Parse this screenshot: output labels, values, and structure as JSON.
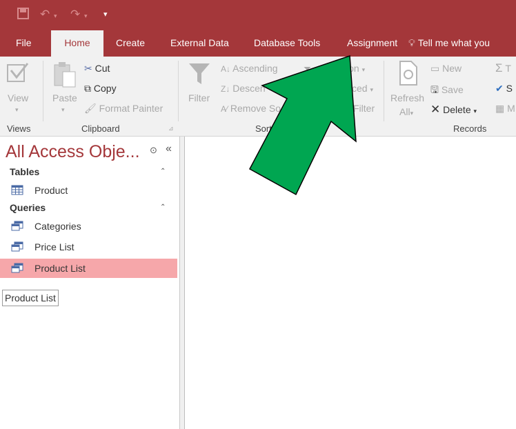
{
  "tabs": [
    "File",
    "Home",
    "Create",
    "External Data",
    "Database Tools",
    "Assignment"
  ],
  "tell_me": "Tell me what you",
  "ribbon": {
    "view": "View",
    "paste": "Paste",
    "cut": "Cut",
    "copy": "Copy",
    "format_painter": "Format Painter",
    "filter": "Filter",
    "ascending": "Ascending",
    "descending": "Descen",
    "remove_sort": "Remove So",
    "selection": "on",
    "advanced": "ced",
    "toggle_filter": "Filter",
    "refresh": "Refresh",
    "refresh_all": "All",
    "new": "New",
    "save": "Save",
    "delete": "Delete",
    "totals_partial": "T",
    "spelling_partial": "S",
    "more_partial": "M",
    "groups": {
      "views": "Views",
      "clipboard": "Clipboard",
      "sort": "Sort",
      "records": "Records"
    }
  },
  "nav": {
    "title": "All Access Obje...",
    "sections": [
      {
        "label": "Tables",
        "items": [
          "Product"
        ]
      },
      {
        "label": "Queries",
        "items": [
          "Categories",
          "Price List",
          "Product List"
        ]
      }
    ],
    "selected": "Product List",
    "tooltip": "Product List"
  },
  "colors": {
    "brand": "#a4373a",
    "selected_row": "#f6a7aa",
    "arrow": "#00a651"
  }
}
